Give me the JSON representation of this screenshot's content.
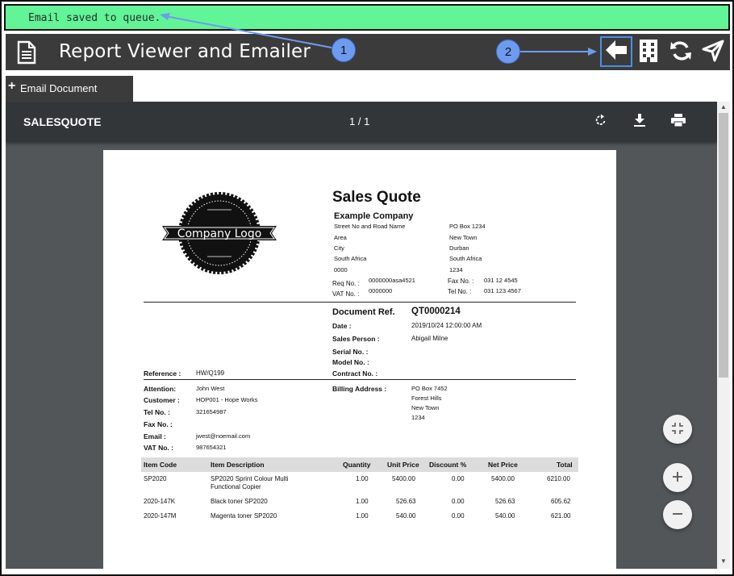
{
  "toast": {
    "message": "Email saved to queue."
  },
  "header": {
    "title": "Report Viewer and Emailer"
  },
  "tabs": [
    {
      "label": "Email Document"
    }
  ],
  "pdf_toolbar": {
    "doc_name": "SALESQUOTE",
    "page_indicator": "1 / 1"
  },
  "quote": {
    "title": "Sales Quote",
    "logo_text": "Company Logo",
    "company": {
      "name": "Example Company",
      "address_left": [
        "Street No and Road Name",
        "Area",
        "City",
        "South Africa",
        "0000"
      ],
      "address_right": [
        "PO Box 1234",
        "New Town",
        "Durban",
        "South Africa",
        "1234"
      ],
      "req_label": "Req No. :",
      "req_value": "0000000asa4521",
      "vat_label": "VAT No. :",
      "vat_value": "0000000",
      "fax_label": "Fax No. :",
      "fax_value": "031 12 4545",
      "tel_label": "Tel No. :",
      "tel_value": "031 123 4567"
    },
    "doc_ref_label": "Document Ref.",
    "doc_ref_value": "QT0000214",
    "date_label": "Date :",
    "date_value": "2019/10/24 12:00:00 AM",
    "salesperson_label": "Sales Person :",
    "salesperson_value": "Abigail Milne",
    "serial_label": "Serial No. :",
    "model_label": "Model No. :",
    "contract_label": "Contract No. :",
    "reference_label": "Reference :",
    "reference_value": "HW/Q199",
    "customer": {
      "attention_label": "Attention:",
      "attention_value": "John West",
      "customer_label": "Customer :",
      "customer_value": "HOP001 - Hope Works",
      "tel_label": "Tel No. :",
      "tel_value": "321654987",
      "fax_label": "Fax No. :",
      "email_label": "Email :",
      "email_value": "jwest@noemail.com",
      "vat_label": "VAT No. :",
      "vat_value": "987654321"
    },
    "billing_label": "Billing Address :",
    "billing_lines": [
      "PO Box 7452",
      "Forest Hills",
      "New Town",
      "1234"
    ],
    "table": {
      "headers": [
        "Item Code",
        "Item Description",
        "Quantity",
        "Unit Price",
        "Discount %",
        "Net Price",
        "Total"
      ],
      "rows": [
        [
          "SP2020",
          "SP2020 Sprint Colour Multi",
          "1.00",
          "5400.00",
          "0.00",
          "5400.00",
          "6210.00"
        ],
        [
          "2020-147K",
          "Black toner SP2020",
          "1.00",
          "526.63",
          "0.00",
          "526.63",
          "605.62"
        ],
        [
          "2020-147M",
          "Magenta toner SP2020",
          "1.00",
          "540.00",
          "0.00",
          "540.00",
          "621.00"
        ]
      ],
      "row1_desc_line2": "Functional Copier"
    }
  },
  "callouts": [
    {
      "label": "1"
    },
    {
      "label": "2"
    }
  ],
  "colors": {
    "toast_bg": "#61f597",
    "titlebar_bg": "#3b3b3b",
    "callout": "#6e9bef",
    "pdf_toolbar": "#323639",
    "viewer_bg": "#525659"
  },
  "icons": [
    "document-icon",
    "back-arrow-icon",
    "building-icon",
    "refresh-icon",
    "send-icon",
    "rotate-icon",
    "download-icon",
    "print-icon",
    "fit-page-icon",
    "zoom-in-icon",
    "zoom-out-icon"
  ]
}
